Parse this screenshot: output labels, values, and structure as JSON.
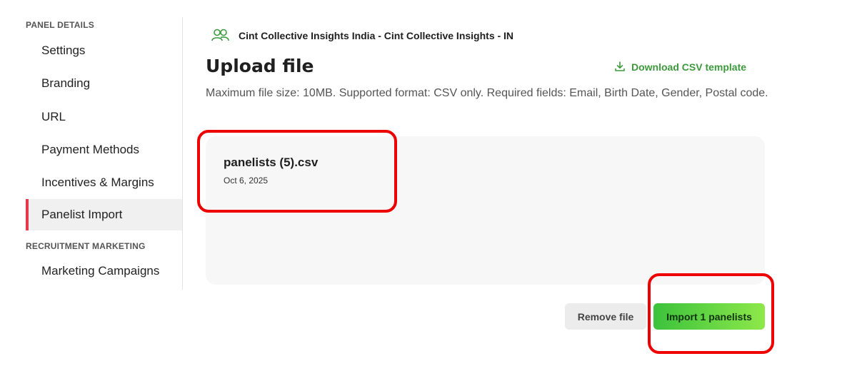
{
  "sidebar": {
    "sections": [
      {
        "header": "PANEL DETAILS"
      },
      {
        "header": "RECRUITMENT MARKETING"
      }
    ],
    "items": [
      {
        "label": "Settings"
      },
      {
        "label": "Branding"
      },
      {
        "label": "URL"
      },
      {
        "label": "Payment Methods"
      },
      {
        "label": "Incentives & Margins"
      },
      {
        "label": "Panelist Import",
        "active": true
      },
      {
        "label": "Marketing Campaigns"
      }
    ]
  },
  "header": {
    "org_icon": "users-icon",
    "org_name": "Cint Collective Insights India - Cint Collective Insights - IN"
  },
  "main": {
    "title": "Upload file",
    "download_link": {
      "icon": "download-icon",
      "label": "Download CSV template"
    },
    "info": "Maximum file size: 10MB. Supported format: CSV only. Required fields: Email, Birth Date, Gender, Postal code.",
    "file": {
      "name": "panelists (5).csv",
      "date": "Oct 6, 2025"
    },
    "buttons": {
      "remove": "Remove file",
      "import": "Import 1 panelists"
    }
  },
  "colors": {
    "accent_green": "#3c9a3c",
    "active_marker": "#e8394a",
    "highlight": "#ee0000"
  }
}
